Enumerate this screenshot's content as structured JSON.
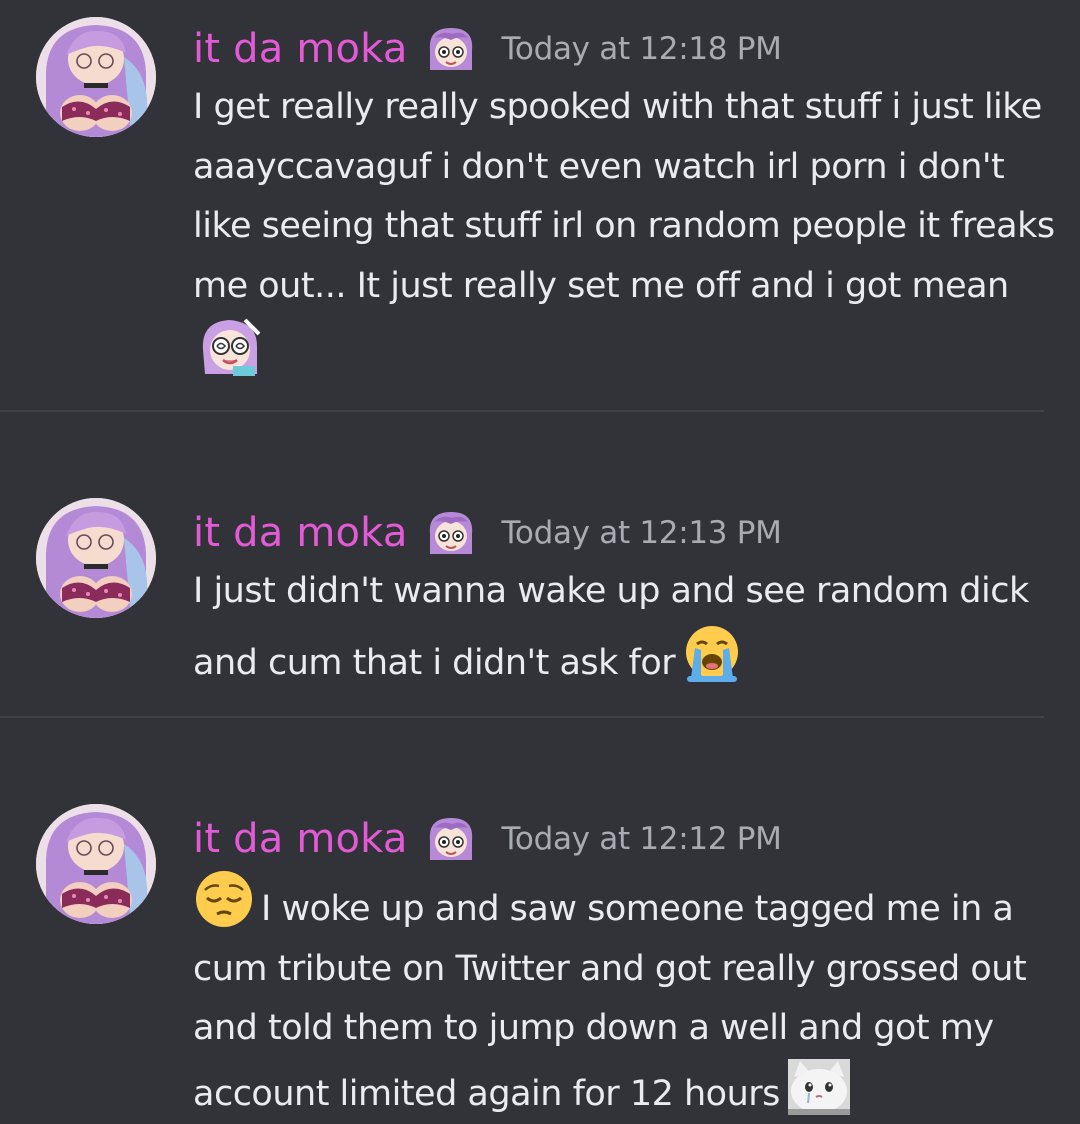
{
  "messages": [
    {
      "username": "it da moka",
      "role_icon": "moka-chibi-icon",
      "timestamp": "Today at 12:18 PM",
      "text": "I get really really spooked with that stuff i just like aaayccavaguf i don't even watch irl porn i don't like seeing that stuff irl on random people it freaks me out... It just really set me off and i got mean",
      "trailing_emoji": "moka-dizzy-emote"
    },
    {
      "username": "it da moka",
      "role_icon": "moka-chibi-icon",
      "timestamp": "Today at 12:13 PM",
      "text": "I just didn't wanna wake up and see random dick and cum that i didn't ask for",
      "trailing_emoji": "loudly-crying-emoji"
    },
    {
      "username": "it da moka",
      "role_icon": "moka-chibi-icon",
      "timestamp": "Today at 12:12 PM",
      "leading_emoji": "pensive-face-emoji",
      "text": "I woke up and saw someone tagged me in a cum tribute on Twitter and got really grossed out and told them to jump down a well and got my account limited again for 12 hours",
      "trailing_emoji": "crying-cat-emote"
    }
  ],
  "colors": {
    "background": "#313338",
    "username": "#e35ad6",
    "timestamp": "#a9abb3",
    "message_text": "#eaebee",
    "divider": "#404249"
  }
}
